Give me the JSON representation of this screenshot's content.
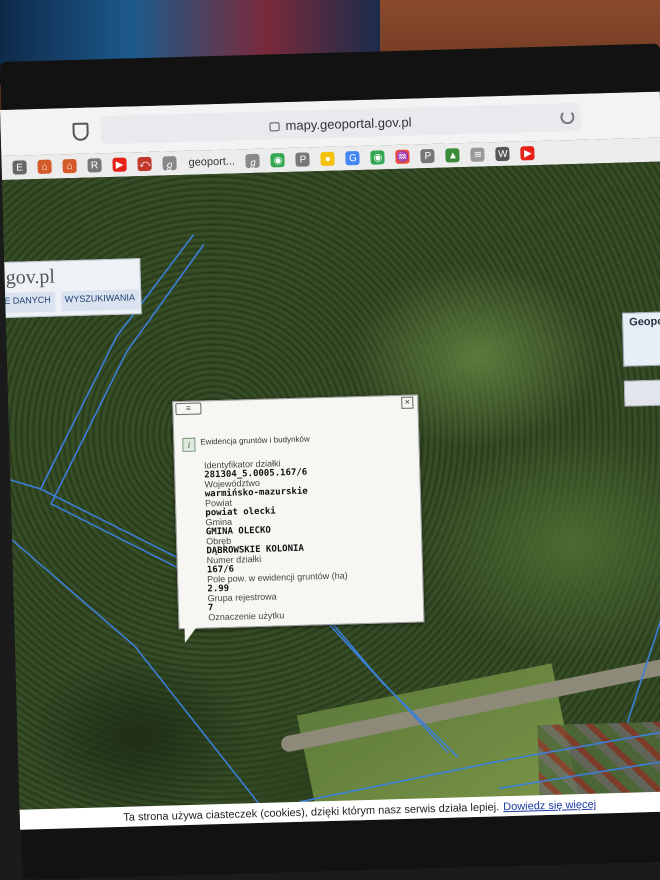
{
  "browser": {
    "url": "mapy.geoportal.gov.pl",
    "active_tab_label": "geoport..."
  },
  "bookmarks": [
    {
      "icon": "e-icon",
      "glyph": "E",
      "color": "#666666"
    },
    {
      "icon": "home-icon",
      "glyph": "⌂",
      "color": "#d45a2a"
    },
    {
      "icon": "home-icon",
      "glyph": "⌂",
      "color": "#d45a2a"
    },
    {
      "icon": "r-icon",
      "glyph": "R",
      "color": "#777777"
    },
    {
      "icon": "youtube-icon",
      "glyph": "▶",
      "color": "#e62117"
    },
    {
      "icon": "site-icon",
      "glyph": "⤺",
      "color": "#c0392b"
    },
    {
      "icon": "geoportal-icon",
      "glyph": "ℊ",
      "color": "#888888"
    },
    {
      "icon": "geoportal-icon",
      "glyph": "ℊ",
      "color": "#888888"
    },
    {
      "icon": "maps-pin-icon",
      "glyph": "◉",
      "color": "#34a853"
    },
    {
      "icon": "p-icon",
      "glyph": "P",
      "color": "#777777"
    },
    {
      "icon": "circle-icon",
      "glyph": "●",
      "color": "#f4c20d"
    },
    {
      "icon": "google-icon",
      "glyph": "G",
      "color": "#4285f4"
    },
    {
      "icon": "maps-pin-icon",
      "glyph": "◉",
      "color": "#34a853"
    },
    {
      "icon": "audio-icon",
      "glyph": "♒",
      "color": "#e84b3c"
    },
    {
      "icon": "p-icon",
      "glyph": "P",
      "color": "#777777"
    },
    {
      "icon": "image-icon",
      "glyph": "▲",
      "color": "#3a8a3a"
    },
    {
      "icon": "wave-icon",
      "glyph": "≋",
      "color": "#999999"
    },
    {
      "icon": "wikipedia-icon",
      "glyph": "W",
      "color": "#555555"
    },
    {
      "icon": "youtube-icon",
      "glyph": "▶",
      "color": "#e62117"
    }
  ],
  "site": {
    "logo_text": "gov.pl",
    "nav": [
      "E DANYCH",
      "WYSZUKIWANIA"
    ],
    "mini_title": "Geopo"
  },
  "popup": {
    "title": "Ewidencja gruntów i budynków",
    "fields": [
      {
        "label": "Identyfikator działki",
        "value": "281304_5.0005.167/6"
      },
      {
        "label": "Województwo",
        "value": "warmińsko-mazurskie"
      },
      {
        "label": "Powiat",
        "value": "powiat olecki"
      },
      {
        "label": "Gmina",
        "value": "GMINA OLECKO"
      },
      {
        "label": "Obręb",
        "value": "DĄBROWSKIE KOLONIA"
      },
      {
        "label": "Numer działki",
        "value": "167/6"
      },
      {
        "label": "Pole pow. w ewidencji gruntów (ha)",
        "value": "2.99"
      },
      {
        "label": "Grupa rejestrowa",
        "value": "7"
      },
      {
        "label": "Oznaczenie użytku",
        "value": ""
      }
    ]
  },
  "cookie_bar": {
    "text": "Ta strona używa ciasteczek (cookies), dzięki którym nasz serwis działa lepiej.",
    "link": "Dowiedz się więcej"
  },
  "colors": {
    "parcel_line": "#3b7fd6",
    "popup_bg": "#f6f6f2",
    "link": "#1a3aa0"
  }
}
